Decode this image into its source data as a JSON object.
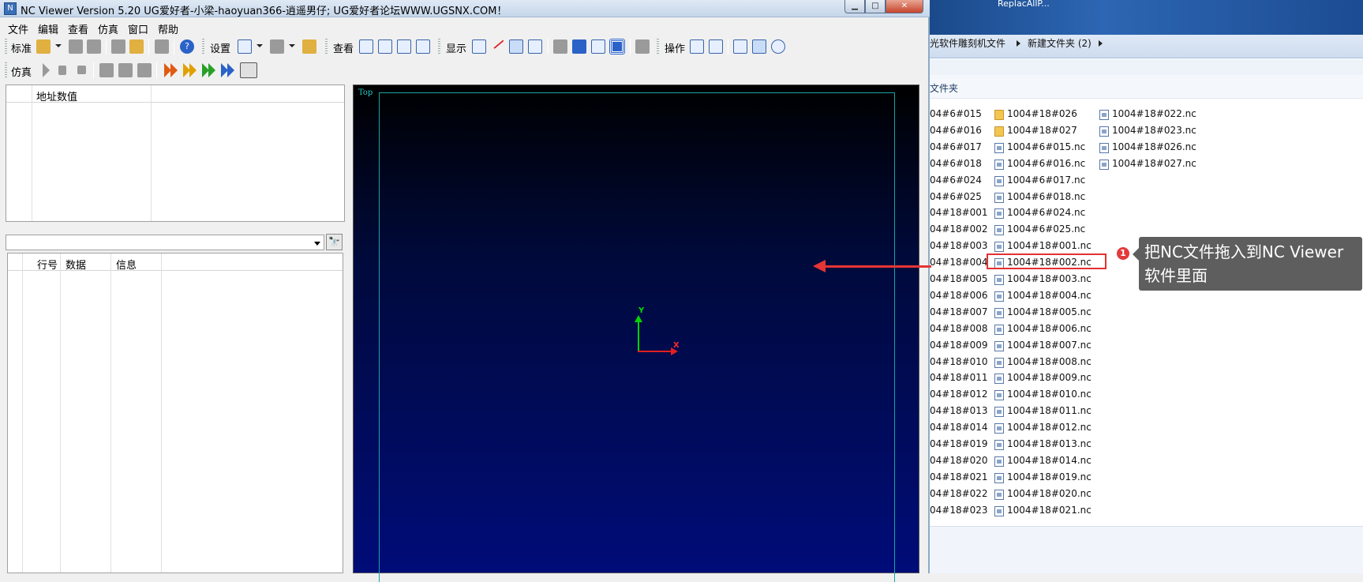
{
  "window": {
    "title": "NC Viewer  Version 5.20  UG爱好者-小梁-haoyuan366-逍遥男仔; UG爱好者论坛WWW.UGSNX.COM！",
    "min_symbol": "▁",
    "max_symbol": "□",
    "close_symbol": "✕"
  },
  "menu": [
    "文件",
    "编辑",
    "查看",
    "仿真",
    "窗口",
    "帮助"
  ],
  "toolbar1": {
    "standard_label": "标准",
    "settings_label": "设置",
    "view_label": "查看",
    "display_label": "显示",
    "operate_label": "操作",
    "help_symbol": "?"
  },
  "toolbar2": {
    "simulate_label": "仿真"
  },
  "address_panel": {
    "column_header": "地址数值"
  },
  "find_button_symbol": "🔭",
  "code_panel": {
    "columns": [
      "行号",
      "数据",
      "信息"
    ]
  },
  "viewport": {
    "view_name": "Top",
    "axis_y": "Y",
    "axis_x": "X",
    "colors": {
      "axis_y": "#00d400",
      "axis_x": "#e02020",
      "frame": "#1aa3a3"
    }
  },
  "explorer": {
    "title_text": "ReplacAllP...",
    "breadcrumb": [
      "光软件雕刻机文件",
      "新建文件夹 (2)"
    ],
    "header": "文件夹",
    "col_a": [
      "04#6#015",
      "04#6#016",
      "04#6#017",
      "04#6#018",
      "04#6#024",
      "04#6#025",
      "04#18#001",
      "04#18#002",
      "04#18#003",
      "04#18#004",
      "04#18#005",
      "04#18#006",
      "04#18#007",
      "04#18#008",
      "04#18#009",
      "04#18#010",
      "04#18#011",
      "04#18#012",
      "04#18#013",
      "04#18#014",
      "04#18#019",
      "04#18#020",
      "04#18#021",
      "04#18#022",
      "04#18#023"
    ],
    "col_b": [
      {
        "name": "1004#18#026",
        "type": "folder"
      },
      {
        "name": "1004#18#027",
        "type": "folder"
      },
      {
        "name": "1004#6#015.nc",
        "type": "file"
      },
      {
        "name": "1004#6#016.nc",
        "type": "file"
      },
      {
        "name": "1004#6#017.nc",
        "type": "file"
      },
      {
        "name": "1004#6#018.nc",
        "type": "file"
      },
      {
        "name": "1004#6#024.nc",
        "type": "file"
      },
      {
        "name": "1004#6#025.nc",
        "type": "file"
      },
      {
        "name": "1004#18#001.nc",
        "type": "file"
      },
      {
        "name": "1004#18#002.nc",
        "type": "file"
      },
      {
        "name": "1004#18#003.nc",
        "type": "file"
      },
      {
        "name": "1004#18#004.nc",
        "type": "file"
      },
      {
        "name": "1004#18#005.nc",
        "type": "file"
      },
      {
        "name": "1004#18#006.nc",
        "type": "file"
      },
      {
        "name": "1004#18#007.nc",
        "type": "file"
      },
      {
        "name": "1004#18#008.nc",
        "type": "file"
      },
      {
        "name": "1004#18#009.nc",
        "type": "file"
      },
      {
        "name": "1004#18#010.nc",
        "type": "file"
      },
      {
        "name": "1004#18#011.nc",
        "type": "file"
      },
      {
        "name": "1004#18#012.nc",
        "type": "file"
      },
      {
        "name": "1004#18#013.nc",
        "type": "file"
      },
      {
        "name": "1004#18#014.nc",
        "type": "file"
      },
      {
        "name": "1004#18#019.nc",
        "type": "file"
      },
      {
        "name": "1004#18#020.nc",
        "type": "file"
      },
      {
        "name": "1004#18#021.nc",
        "type": "file"
      }
    ],
    "col_c": [
      {
        "name": "1004#18#022.nc",
        "type": "file"
      },
      {
        "name": "1004#18#023.nc",
        "type": "file"
      },
      {
        "name": "1004#18#026.nc",
        "type": "file"
      },
      {
        "name": "1004#18#027.nc",
        "type": "file"
      }
    ]
  },
  "annotation": {
    "step": "1",
    "text_line1": "把NC文件拖入到NC Viewer",
    "text_line2": "软件里面",
    "color": "#e53535"
  }
}
